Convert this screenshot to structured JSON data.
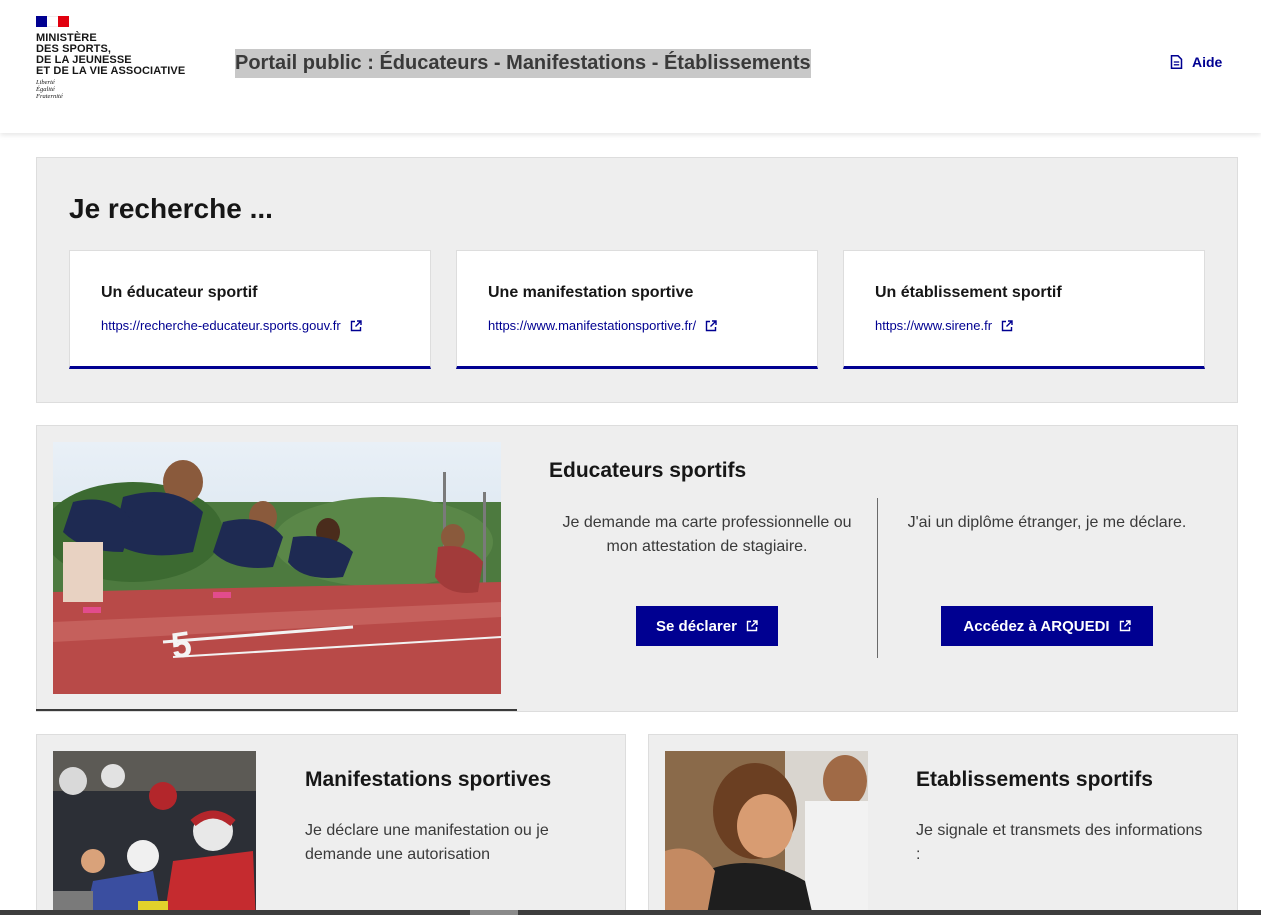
{
  "header": {
    "ministry_lines": [
      "MINISTÈRE",
      "DES SPORTS,",
      "DE LA JEUNESSE",
      "ET DE LA VIE ASSOCIATIVE"
    ],
    "devise_lines": [
      "Liberté",
      "Égalité",
      "Fraternité"
    ],
    "site_title": "Portail public : Éducateurs - Manifestations - Établissements",
    "help_label": "Aide",
    "help_icon": "document-icon"
  },
  "search": {
    "title": "Je recherche ...",
    "cards": [
      {
        "title": "Un éducateur sportif",
        "link": "https://recherche-educateur.sports.gouv.fr"
      },
      {
        "title": "Une manifestation sportive",
        "link": "https://www.manifestationsportive.fr/"
      },
      {
        "title": "Un établissement sportif",
        "link": "https://www.sirene.fr"
      }
    ]
  },
  "educateurs": {
    "title": "Educateurs sportifs",
    "col1_text": "Je demande ma carte professionnelle ou mon attestation de stagiaire.",
    "col1_button": "Se déclarer",
    "col2_text": "J'ai un diplôme étranger, je me déclare.",
    "col2_button": "Accédez à ARQUEDI"
  },
  "manifestations": {
    "title": "Manifestations sportives",
    "text": "Je déclare une manifestation ou je demande une autorisation"
  },
  "etablissements": {
    "title": "Etablissements sportifs",
    "text": "Je signale et transmets des informations :"
  },
  "colors": {
    "brand_blue": "#000091",
    "marianne_red": "#e1000f",
    "section_bg": "#eeeeee"
  }
}
